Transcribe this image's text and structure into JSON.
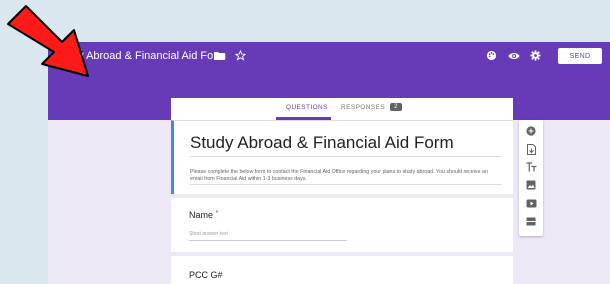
{
  "app": {
    "title": "dy Abroad & Financial Aid Form",
    "send_label": "SEND",
    "accent": "#673ab7"
  },
  "tabs": {
    "questions": "QUESTIONS",
    "responses": "RESPONSES",
    "responses_count": "2"
  },
  "form": {
    "title": "Study Abroad & Financial Aid Form",
    "description": "Please complete the below form to contact the Financial Aid Office regarding your plans to study abroad. You should receive an email from Financial Aid within 1-3 business days."
  },
  "questions": [
    {
      "label": "Name",
      "required_mark": "*",
      "placeholder": "Short answer text"
    },
    {
      "label": "PCC G#"
    }
  ],
  "icons": {
    "title": [
      "folder-icon",
      "star-icon"
    ],
    "header": [
      "palette-icon",
      "preview-eye-icon",
      "settings-gear-icon"
    ],
    "tools": [
      "add-question-icon",
      "import-questions-icon",
      "add-title-icon",
      "add-image-icon",
      "add-video-icon",
      "add-section-icon"
    ]
  },
  "annotation": {
    "color": "#ff1a1a",
    "shape": "arrow"
  }
}
